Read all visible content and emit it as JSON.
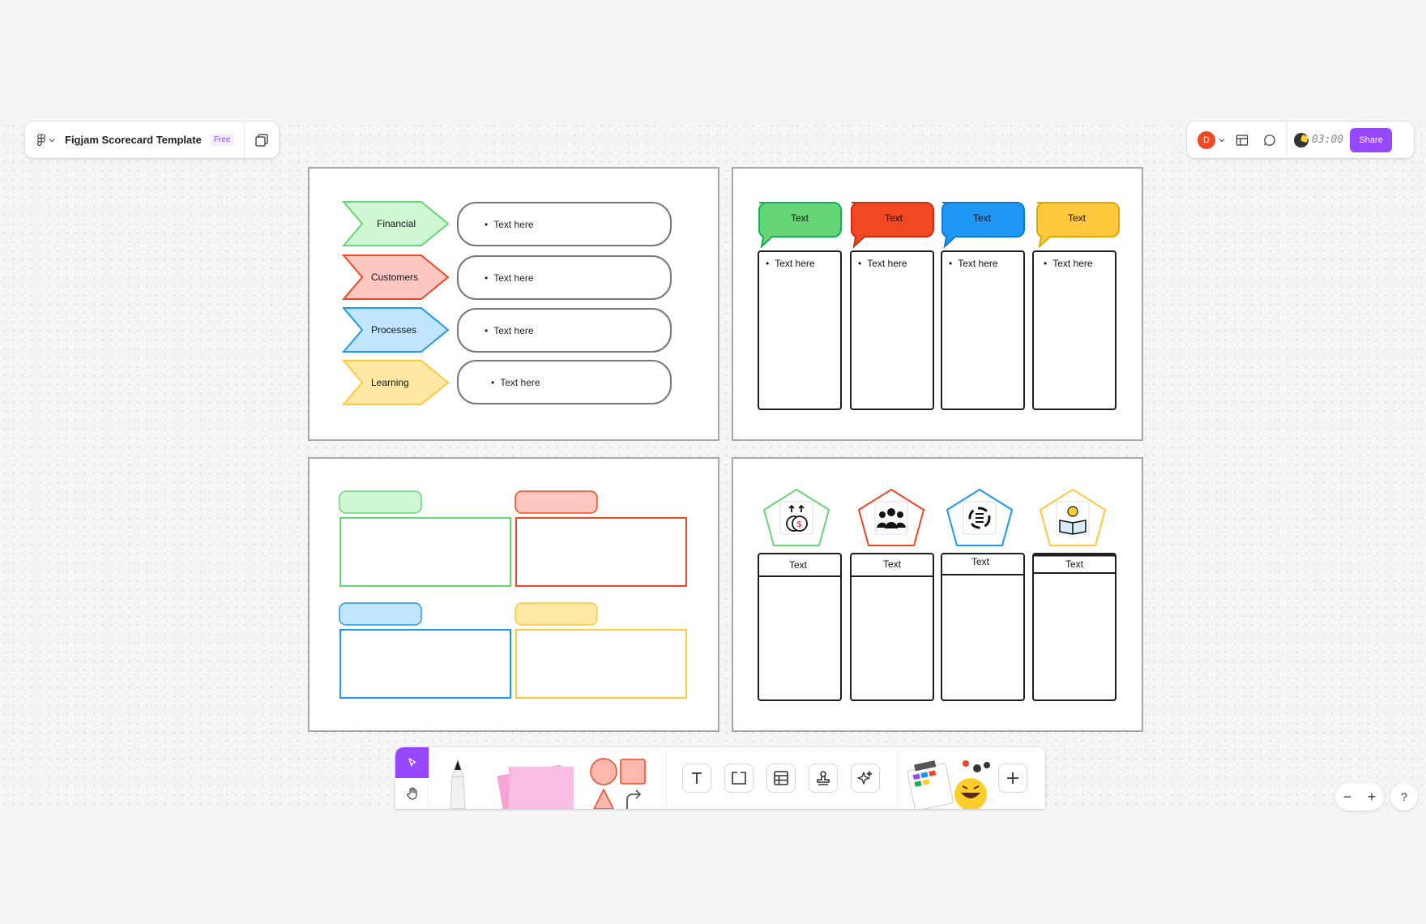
{
  "file": {
    "title": "Figjam Scorecard Template",
    "plan_badge": "Free"
  },
  "user": {
    "initial": "D"
  },
  "timer": {
    "value": "03:00"
  },
  "actions": {
    "share_label": "Share"
  },
  "colors": {
    "green": "#14ae5c",
    "green_fill": "#cff7d3",
    "green_solid": "#66d575",
    "red": "#f24822",
    "red_fill": "#ffc7c2",
    "blue": "#0d99ff",
    "blue_fill": "#c2e5ff",
    "blue_solid": "#1f97f4",
    "yellow": "#ffcd29",
    "yellow_fill": "#ffe8a3",
    "yellow_solid": "#ffc83d",
    "accent": "#9747ff"
  },
  "perspectives": [
    {
      "label": "Financial",
      "text": "Text here"
    },
    {
      "label": "Customers",
      "text": "Text here"
    },
    {
      "label": "Processes",
      "text": "Text here"
    },
    {
      "label": "Learning",
      "text": "Text here"
    }
  ],
  "bubble_columns": [
    {
      "label": "Text",
      "item": "Text here"
    },
    {
      "label": "Text",
      "item": "Text here"
    },
    {
      "label": "Text",
      "item": "Text here"
    },
    {
      "label": "Text",
      "item": "Text here"
    }
  ],
  "icon_columns": [
    {
      "icon": "money-growth-icon",
      "label": "Text"
    },
    {
      "icon": "team-icon",
      "label": "Text"
    },
    {
      "icon": "process-cycle-icon",
      "label": "Text"
    },
    {
      "icon": "learning-book-icon",
      "label": "Text"
    }
  ],
  "toolbar": {
    "tools": [
      "select-tool",
      "hand-tool",
      "marker-tool",
      "sticky-note-tool",
      "shapes-tool",
      "text-tool",
      "section-tool",
      "table-tool",
      "stamp-tool",
      "ai-tool",
      "templates-tool",
      "more-tool"
    ]
  }
}
